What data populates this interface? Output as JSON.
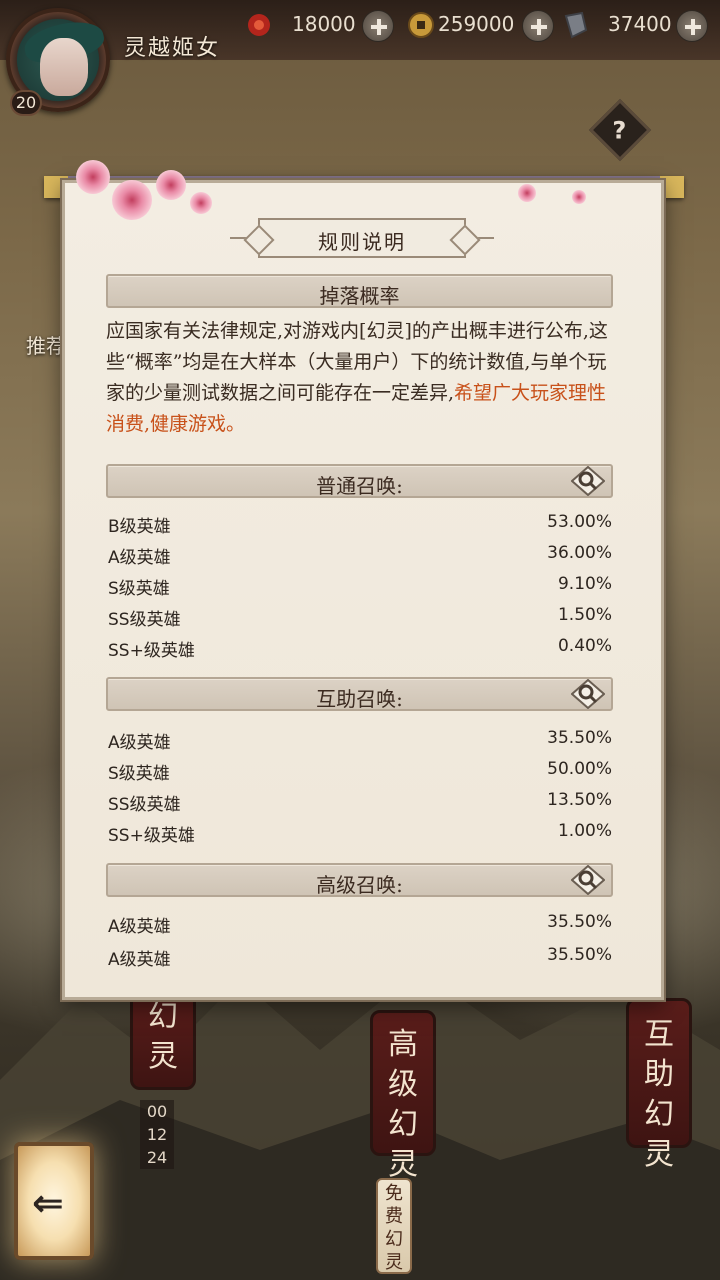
{
  "topbar": {
    "player_name": "灵越姬女",
    "level": "20",
    "resources": [
      {
        "icon": "jade-orb-icon",
        "value": "18000"
      },
      {
        "icon": "coin-icon",
        "value": "259000"
      },
      {
        "icon": "crystal-icon",
        "value": "37400"
      }
    ]
  },
  "background": {
    "side_tag": "推荐",
    "scroll_left": "幻灵",
    "scroll_mid": "高级幻灵",
    "scroll_right": "互助幻灵",
    "timer": [
      "00",
      "12",
      "24"
    ],
    "free_tag": "免费幻灵"
  },
  "panel": {
    "title": "规则说明",
    "drop_rate_header": "掉落概率",
    "description_plain": "应国家有关法律规定,对游戏内[幻灵]的产出概丰进行公布,这些“概率”均是在大样本（大量用户）下的统计数值,与单个玩家的少量测试数据之间可能存在一定差异,",
    "description_highlight": "希望广大玩家理性消费,健康游戏。",
    "sections": [
      {
        "title": "普通召唤:",
        "rows": [
          {
            "label": "B级英雄",
            "value": "53.00%"
          },
          {
            "label": "A级英雄",
            "value": "36.00%"
          },
          {
            "label": "S级英雄",
            "value": "9.10%"
          },
          {
            "label": "SS级英雄",
            "value": "1.50%"
          },
          {
            "label": "SS+级英雄",
            "value": "0.40%"
          }
        ]
      },
      {
        "title": "互助召唤:",
        "rows": [
          {
            "label": "A级英雄",
            "value": "35.50%"
          },
          {
            "label": "S级英雄",
            "value": "50.00%"
          },
          {
            "label": "SS级英雄",
            "value": "13.50%"
          },
          {
            "label": "SS+级英雄",
            "value": "1.00%"
          }
        ]
      },
      {
        "title": "高级召唤:",
        "rows": [
          {
            "label": "A级英雄",
            "value": "35.50%"
          },
          {
            "label": "A级英雄",
            "value": "35.50%"
          }
        ]
      }
    ]
  },
  "colors": {
    "highlight": "#c8511a",
    "panel_bg": "#f3ede2",
    "bar_bg": "#d6ccbe"
  }
}
